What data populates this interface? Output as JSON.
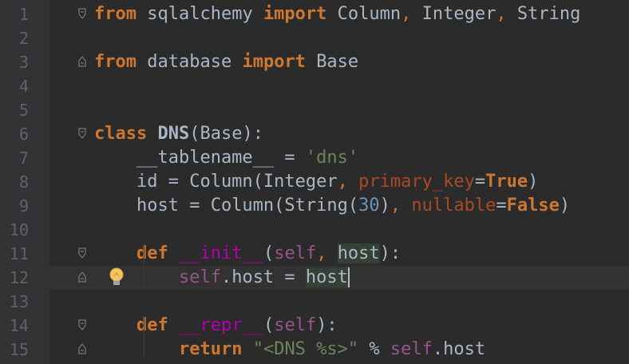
{
  "editor": {
    "lines": [
      {
        "n": "1",
        "tokens": [
          [
            "kw",
            "from"
          ],
          [
            "",
            "sqlalchemy "
          ],
          [
            "kw",
            "import"
          ],
          [
            "",
            "Column"
          ],
          [
            "op",
            ","
          ],
          [
            "",
            "Integer"
          ],
          [
            "op",
            ","
          ],
          [
            "",
            "String"
          ]
        ]
      },
      {
        "n": "2",
        "tokens": []
      },
      {
        "n": "3",
        "tokens": [
          [
            "kw",
            "from"
          ],
          [
            "",
            "database "
          ],
          [
            "kw",
            "import"
          ],
          [
            "",
            "Base"
          ]
        ]
      },
      {
        "n": "4",
        "tokens": []
      },
      {
        "n": "5",
        "tokens": []
      },
      {
        "n": "6",
        "tokens": [
          [
            "kw",
            "class"
          ],
          [
            "cls",
            "DNS"
          ],
          [
            "",
            "(Base):"
          ]
        ]
      },
      {
        "n": "7",
        "tokens": [
          [
            "",
            "    __tablename__ = "
          ],
          [
            "str",
            "'dns'"
          ]
        ]
      },
      {
        "n": "8",
        "tokens": [
          [
            "",
            "    id = Column(Integer"
          ],
          [
            "op",
            ","
          ],
          [
            "param",
            "primary_key"
          ],
          [
            "",
            "="
          ],
          [
            "kw",
            "True"
          ],
          [
            "",
            ")"
          ]
        ]
      },
      {
        "n": "9",
        "tokens": [
          [
            "",
            "    host = Column(String("
          ],
          [
            "num",
            "30"
          ],
          [
            "",
            ")"
          ],
          [
            "op",
            ","
          ],
          [
            "param",
            "nullable"
          ],
          [
            "",
            "="
          ],
          [
            "kw",
            "False"
          ],
          [
            "",
            ")"
          ]
        ]
      },
      {
        "n": "10",
        "tokens": []
      },
      {
        "n": "11",
        "tokens": [
          [
            "",
            "    "
          ],
          [
            "kw",
            "def"
          ],
          [
            "dunder",
            "__init__"
          ],
          [
            "",
            "("
          ],
          [
            "self",
            "self"
          ],
          [
            "op",
            ","
          ],
          [
            "hl",
            "host"
          ],
          [
            "",
            "):"
          ]
        ]
      },
      {
        "n": "12",
        "tokens": [
          [
            "",
            "        "
          ],
          [
            "self",
            "self"
          ],
          [
            "",
            ".host = "
          ],
          [
            "hlcaret",
            "host"
          ]
        ]
      },
      {
        "n": "13",
        "tokens": []
      },
      {
        "n": "14",
        "tokens": [
          [
            "",
            "    "
          ],
          [
            "kw",
            "def"
          ],
          [
            "dunder",
            "__repr__"
          ],
          [
            "",
            "("
          ],
          [
            "self",
            "self"
          ],
          [
            "",
            "):"
          ]
        ]
      },
      {
        "n": "15",
        "tokens": [
          [
            "",
            "        "
          ],
          [
            "kw",
            "return"
          ],
          [
            "str",
            "\"<DNS %s>\""
          ],
          [
            "",
            " % "
          ],
          [
            "self",
            "self"
          ],
          [
            "",
            ".host"
          ]
        ]
      }
    ],
    "folds": {
      "1": "open",
      "3": "close",
      "6": "open",
      "11": "open",
      "12": "close",
      "14": "open",
      "15": "close"
    },
    "current_line": "12",
    "intention_icon": "lightbulb-icon",
    "colors": {
      "background": "#2b2b2b",
      "gutter": "#313335",
      "keyword": "#cc7832",
      "string": "#6a8759",
      "number": "#6897bb",
      "self": "#94558d",
      "dunder": "#b200b2"
    }
  }
}
